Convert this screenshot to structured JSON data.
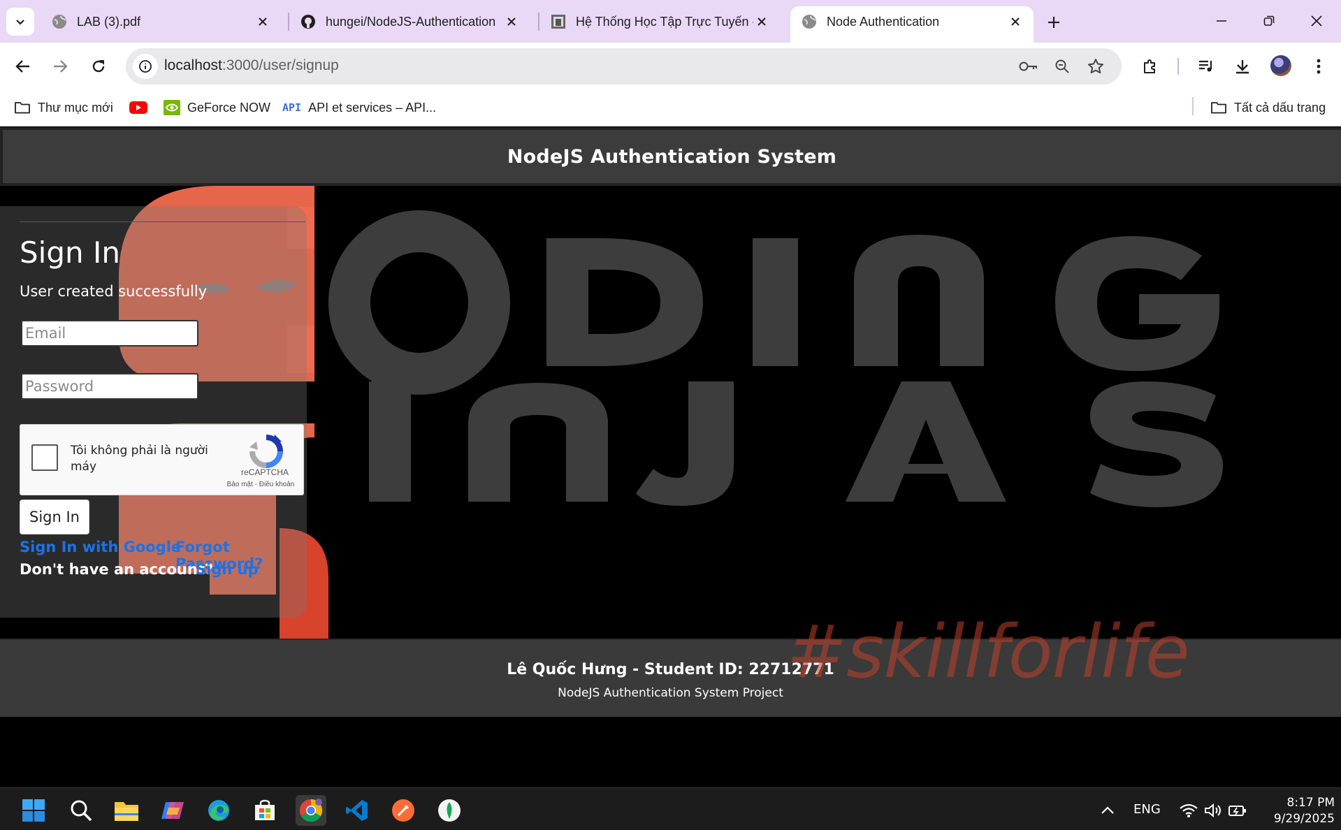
{
  "browser": {
    "tabs": [
      {
        "label": "LAB (3).pdf",
        "icon": "globe-icon"
      },
      {
        "label": "hungei/NodeJS-Authentication",
        "icon": "github-icon"
      },
      {
        "label": "Hệ Thống Học Tập Trực Tuyến -",
        "icon": "school-icon"
      },
      {
        "label": "Node Authentication",
        "icon": "globe-icon",
        "active": true
      }
    ],
    "url_host": "localhost",
    "url_path": ":3000/user/signup",
    "bookmarks": [
      {
        "label": "Thư mục mới",
        "icon": "folder-icon"
      },
      {
        "label": "",
        "icon": "youtube-icon"
      },
      {
        "label": "GeForce NOW",
        "icon": "nvidia-icon"
      },
      {
        "label": "API et services – API...",
        "icon": "api-icon"
      }
    ],
    "all_bookmarks": "Tất cả dấu trang"
  },
  "page": {
    "header_title": "NodeJS Authentication System",
    "background_text": {
      "line1": "ODING",
      "line2": "INJAS",
      "hashtag": "#skillforlife"
    },
    "signin": {
      "title": "Sign In",
      "message": "User created successfully",
      "email_placeholder": "Email",
      "password_placeholder": "Password",
      "captcha_label": "Tôi không phải là người máy",
      "captcha_brand": "reCAPTCHA",
      "captcha_terms": "Bảo mật - Điều khoản",
      "submit_label": "Sign In",
      "google_link": "Sign In with Google",
      "forgot_link": "Forgot Password?",
      "no_account_text": "Don't have an account?",
      "signup_link": "Sign up"
    },
    "footer": {
      "name": "Lê Quốc Hưng - Student ID: 22712771",
      "subtitle": "NodeJS Authentication System Project"
    }
  },
  "taskbar": {
    "language": "ENG",
    "time": "8:17 PM",
    "date": "9/29/2025"
  },
  "colors": {
    "tabbar": "#e9d8f6",
    "link": "#1a73e8",
    "brand_orange": "#f26b4f",
    "header_bg": "#3c3c3c"
  }
}
